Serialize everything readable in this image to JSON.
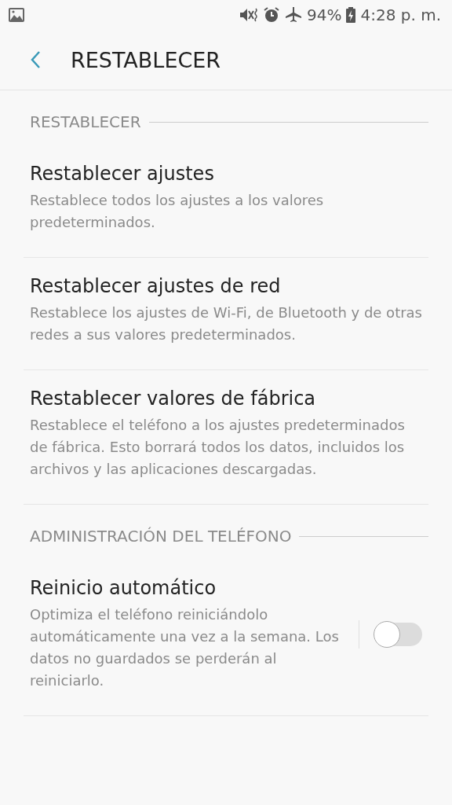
{
  "status_bar": {
    "battery": "94%",
    "time": "4:28 p. m."
  },
  "app_bar": {
    "title": "RESTABLECER"
  },
  "sections": [
    {
      "header": "RESTABLECER",
      "items": [
        {
          "kind": "link",
          "title": "Restablecer ajustes",
          "description": "Restablece todos los ajustes a los valores predeterminados."
        },
        {
          "kind": "link",
          "title": "Restablecer ajustes de red",
          "description": "Restablece los ajustes de Wi-Fi, de Bluetooth y de otras redes a sus valores predeterminados."
        },
        {
          "kind": "link",
          "title": "Restablecer valores de fábrica",
          "description": "Restablece el teléfono a los ajustes predeterminados de fábrica. Esto borrará todos los datos, incluidos los archivos y las aplicaciones descargadas."
        }
      ]
    },
    {
      "header": "ADMINISTRACIÓN DEL TELÉFONO",
      "items": [
        {
          "kind": "toggle",
          "title": "Reinicio automático",
          "description": "Optimiza el teléfono reiniciándolo automáticamente una vez a la semana. Los datos no guardados se perderán al reiniciarlo.",
          "on": false
        }
      ]
    }
  ]
}
